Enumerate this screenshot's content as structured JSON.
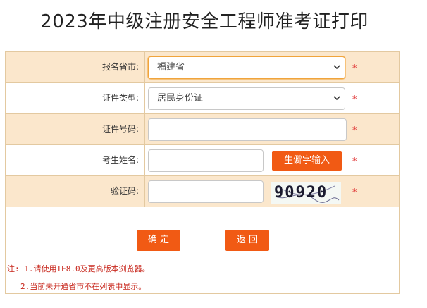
{
  "page": {
    "title": "2023年中级注册安全工程师准考证打印"
  },
  "form": {
    "province": {
      "label": "报名省市:",
      "value": "福建省"
    },
    "id_type": {
      "label": "证件类型:",
      "value": "居民身份证"
    },
    "id_number": {
      "label": "证件号码:",
      "value": ""
    },
    "name": {
      "label": "考生姓名:",
      "value": "",
      "rare_char_button": "生僻字输入"
    },
    "captcha": {
      "label": "验证码:",
      "value": "",
      "image_text": "90920"
    },
    "required_mark": "*"
  },
  "buttons": {
    "confirm": "确 定",
    "back": "返 回"
  },
  "notes": {
    "line1": "注: 1.请使用IE8.0及更高版本浏览器。",
    "line2": "2.当前未开通省市不在列表中显示。"
  },
  "colors": {
    "accent": "#f15a14",
    "row_shade": "#fbe7cc",
    "border": "#e3c9a0",
    "note": "#c8281e"
  }
}
